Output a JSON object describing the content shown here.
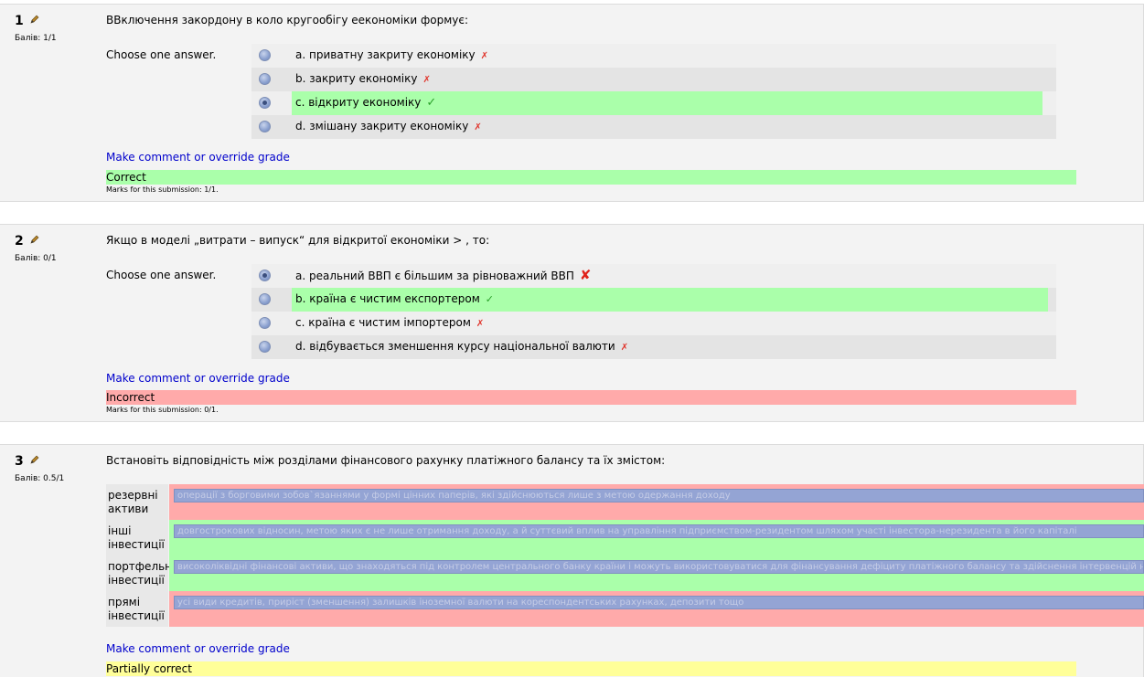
{
  "questions": [
    {
      "number": "1",
      "grade": "Бaлів: 1/1",
      "text": "ВВключення закордону в коло кругообігу еекономіки формує:",
      "prompt": "Choose one answer.",
      "answers": [
        {
          "label": "a. приватну закриту економіку",
          "mark": "✗",
          "checked": false,
          "correct": false
        },
        {
          "label": "b. закриту економіку",
          "mark": "✗",
          "checked": false,
          "correct": false
        },
        {
          "label": "c. відкриту економіку",
          "mark": "✓",
          "checked": true,
          "correct": true
        },
        {
          "label": "d. змішану закриту економіку",
          "mark": "✗",
          "checked": false,
          "correct": false
        }
      ],
      "comment_link": "Make comment or override grade",
      "status": "Correct",
      "marks": "Marks for this submission: 1/1."
    },
    {
      "number": "2",
      "grade": "Бaлів: 0/1",
      "text": "Якщо в моделі „витрати – випуск“ для відкритої економіки > , то:",
      "prompt": "Choose one answer.",
      "answers": [
        {
          "label": "a. реальний ВВП є більшим за рівноважний ВВП",
          "mark": "✘",
          "checked": true,
          "correct": false
        },
        {
          "label": "b. країна є чистим експортером",
          "mark": "✓",
          "checked": false,
          "correct": true
        },
        {
          "label": "c. країна є чистим імпортером",
          "mark": "✗",
          "checked": false,
          "correct": false
        },
        {
          "label": "d. відбувається зменшення курсу національної валюти",
          "mark": "✗",
          "checked": false,
          "correct": false
        }
      ],
      "comment_link": "Make comment or override grade",
      "status": "Incorrect",
      "marks": "Marks for this submission: 0/1."
    },
    {
      "number": "3",
      "grade": "Бaлів: 0.5/1",
      "text": "Встановіть відповідність між розділами фінансового рахунку платіжного балансу та їх змістом:",
      "rows": [
        {
          "label": "резервні активи",
          "value": "операції з борговими зобов`язаннями у формі цінних паперів, які здійснюються лише з метою одержання доходу",
          "correct": false
        },
        {
          "label": "інші інвестиції",
          "value": "довгострокових відносин, метою яких є не лише отримання доходу, а й суттєвий вплив на управління підприємством-резидентом шляхом участі інвестора-нерезидента в його капіталі",
          "correct": true
        },
        {
          "label": "портфельні інвестиції",
          "value": "високоліквідні фінансові активи, що знаходяться під контролем центрального банку країни і можуть використовуватися для фінансування дефіциту платіжного балансу та здійснення інтервенцій на валютному",
          "correct": true
        },
        {
          "label": "прямі інвестиції",
          "value": "усі види кредитів, приріст (зменшення) залишків іноземної валюти на кореспондентських рахунках, депозити тощо",
          "correct": false
        }
      ],
      "comment_link": "Make comment or override grade",
      "status": "Partially correct"
    }
  ],
  "colors": {
    "correct_bg": "#aaffaa",
    "incorrect_bg": "#ffaaaa",
    "partial_bg": "#ffff99",
    "link": "#0000cc"
  },
  "icons": {
    "edit": "pencil-icon",
    "right": "check-icon",
    "wrong": "cross-icon"
  }
}
